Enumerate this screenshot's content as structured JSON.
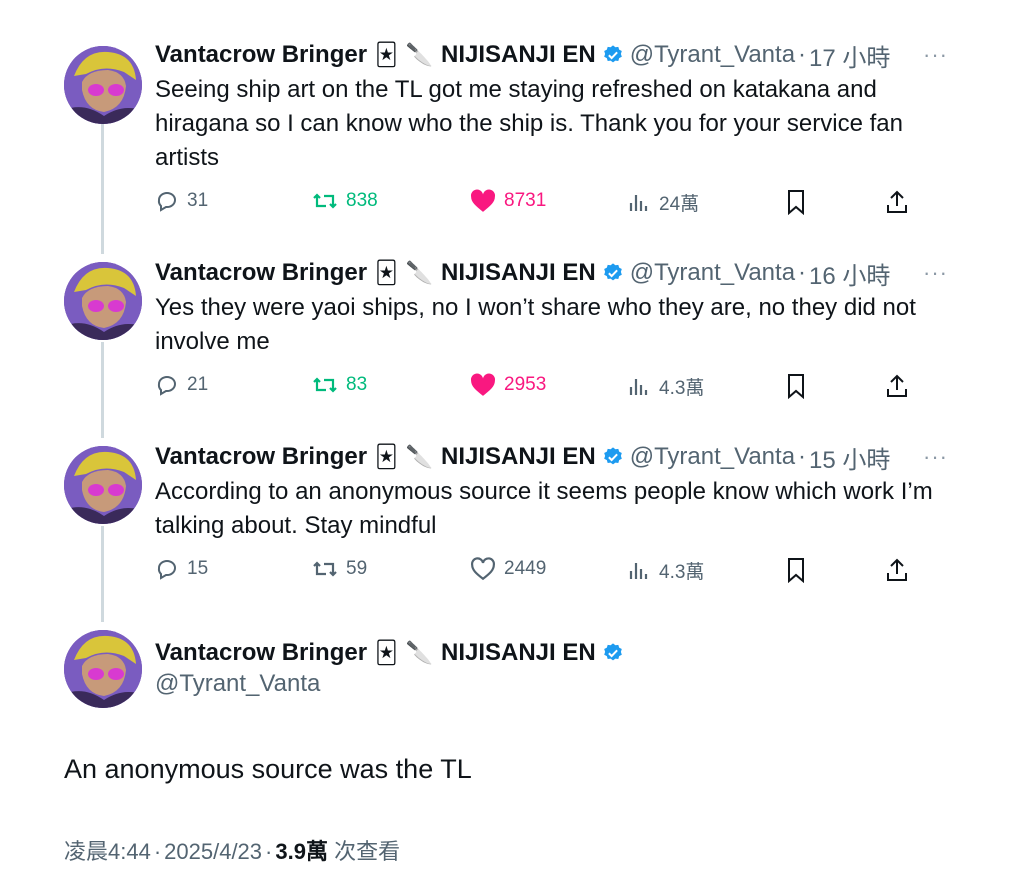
{
  "author": {
    "name": "Vantacrow Bringer",
    "emoji_1": "🃏",
    "emoji_2": "🔪",
    "org": "NIJISANJI EN",
    "handle": "@Tyrant_Vanta"
  },
  "icons": {
    "verified": "verified-badge-icon",
    "more": "more-icon",
    "reply": "reply-icon",
    "retweet": "retweet-icon",
    "like": "heart-icon",
    "views": "views-icon",
    "bookmark": "bookmark-icon",
    "share": "share-icon"
  },
  "colors": {
    "text": "#0f1419",
    "muted": "#536471",
    "verified": "#1d9bf0",
    "retweet_active": "#00ba7c",
    "like_active": "#f91880",
    "thread_line": "#cfd9de"
  },
  "more_glyph": "···",
  "tweets": [
    {
      "time": "17 小時",
      "text": "Seeing ship art on the TL got me staying refreshed on katakana and hiragana so I can know who the ship is. Thank you for your service fan artists",
      "replies": "31",
      "retweets": "838",
      "likes": "8731",
      "views": "24萬",
      "retweeted": true,
      "liked": true
    },
    {
      "time": "16 小時",
      "text": "Yes they were yaoi ships, no I won’t share who they are, no they did not involve me",
      "replies": "21",
      "retweets": "83",
      "likes": "2953",
      "views": "4.3萬",
      "retweeted": true,
      "liked": true
    },
    {
      "time": "15 小時",
      "text": "According to an anonymous source it seems people know which work I’m talking about. Stay mindful",
      "replies": "15",
      "retweets": "59",
      "likes": "2449",
      "views": "4.3萬",
      "retweeted": false,
      "liked": false
    }
  ],
  "main_tweet": {
    "text": "An anonymous source was the TL",
    "time": "凌晨4:44",
    "date": "2025/4/23",
    "views": "3.9萬",
    "views_label": "次查看"
  }
}
